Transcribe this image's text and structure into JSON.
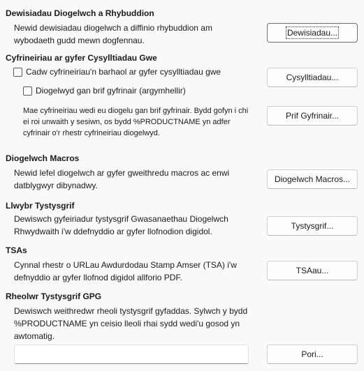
{
  "security_warnings": {
    "heading": "Dewisiadau Diogelwch a Rhybuddion",
    "description": "Newid dewisiadau diogelwch a diffinio rhybuddion am wybodaeth gudd mewn dogfennau.",
    "button": "Dewisiadau..."
  },
  "web_passwords": {
    "heading": "Cyfrineiriau ar gyfer Cysylltiadau Gwe",
    "persist_checkbox": "Cadw cyfrineiriau'n barhaol ar gyfer cysylltiadau gwe",
    "master_checkbox": "Diogelwyd gan brif gyfrinair (argymhellir)",
    "connections_button": "Cysylltiadau...",
    "note": "Mae cyfrineiriau wedi eu diogelu gan brif gyfrinair. Bydd gofyn i chi ei roi unwaith y sesiwn, os bydd %PRODUCTNAME yn adfer cyfrinair o'r rhestr cyfrineiriau diogelwyd.",
    "master_button": "Prif Gyfrinair..."
  },
  "macro_security": {
    "heading": "Diogelwch Macros",
    "description": "Newid lefel diogelwch ar gyfer gweithredu macros ac enwi datblygwyr dibynadwy.",
    "button": "Diogelwch Macros..."
  },
  "cert_path": {
    "heading": "Llwybr Tystysgrif",
    "description": "Dewiswch gyfeiriadur tystysgrif Gwasanaethau Diogelwch Rhwydwaith i'w ddefnyddio ar gyfer llofnodion digidol.",
    "button": "Tystysgrif..."
  },
  "tsas": {
    "heading": "TSAs",
    "description": "Cynnal rhestr o URLau Awdurdodau Stamp Amser (TSA) i'w defnyddio ar gyfer llofnod digidol allforio PDF.",
    "button": "TSAau..."
  },
  "gpg": {
    "heading": "Rheolwr Tystysgrif GPG",
    "description": "Dewiswch weithredwr rheoli tystysgrif gyfaddas. Sylwch y bydd %PRODUCTNAME yn ceisio lleoli rhai sydd wedi'u gosod yn awtomatig.",
    "field_value": "",
    "button": "Pori..."
  }
}
